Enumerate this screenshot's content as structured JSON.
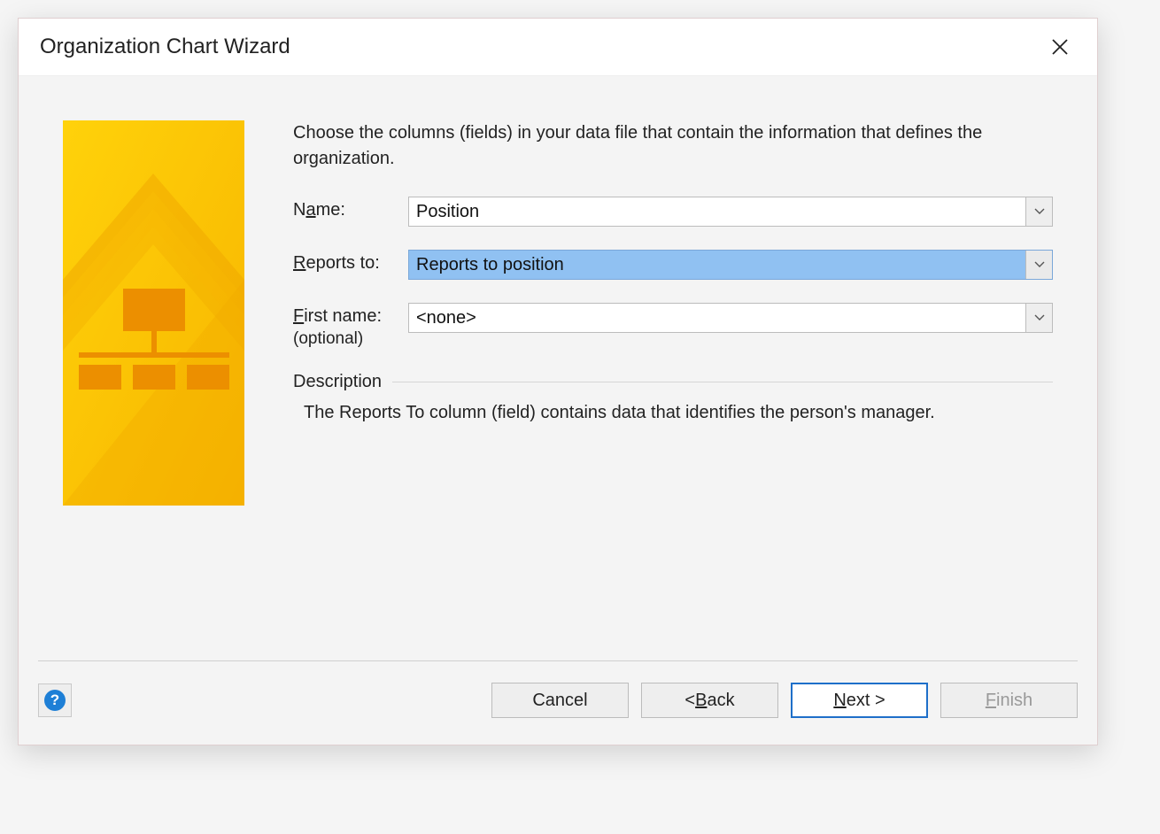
{
  "titlebar": {
    "title": "Organization Chart Wizard"
  },
  "content": {
    "instruction": "Choose the columns (fields) in your data file that contain the information that defines the organization.",
    "fields": {
      "name": {
        "label_prefix": "N",
        "label_accel": "a",
        "label_suffix": "me:",
        "value": "Position"
      },
      "reports_to": {
        "label_accel": "R",
        "label_suffix": "eports to:",
        "value": "Reports to position"
      },
      "first_name": {
        "label_accel": "F",
        "label_suffix": "irst name:",
        "sub_label": "(optional)",
        "value": "<none>"
      }
    },
    "description": {
      "title": "Description",
      "text": "The Reports To column (field) contains data that identifies the person's manager."
    }
  },
  "footer": {
    "help_glyph": "?",
    "cancel": "Cancel",
    "back_prefix": "< ",
    "back_accel": "B",
    "back_suffix": "ack",
    "next_accel": "N",
    "next_suffix": "ext >",
    "finish_accel": "F",
    "finish_suffix": "inish"
  }
}
